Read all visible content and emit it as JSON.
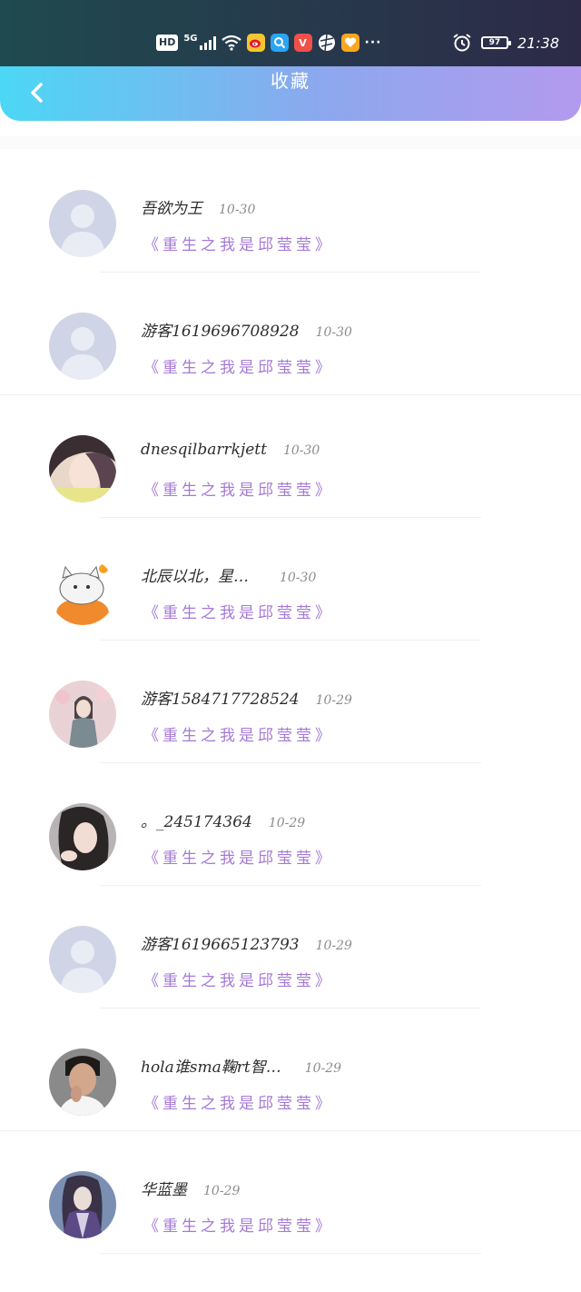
{
  "status_bar": {
    "hd": "HD",
    "network": "5G",
    "battery": "97",
    "time": "21:38",
    "more": "···",
    "app_icons": [
      "weibo-icon",
      "search-app-icon",
      "vip-app-icon",
      "browser-icon",
      "heart-app-icon"
    ]
  },
  "header": {
    "title": "收藏",
    "back_icon": "chevron-left-icon",
    "gradient": [
      "#4cd7f5",
      "#b39aee"
    ]
  },
  "accent_color": "#a57ad6",
  "items": [
    {
      "name": "吾欲为王",
      "date": "10-30",
      "book": "《重生之我是邱莹莹》",
      "avatar": "default"
    },
    {
      "name": "游客1619696708928",
      "date": "10-30",
      "book": "《重生之我是邱莹莹》",
      "avatar": "default"
    },
    {
      "name": "dnesqilbarrkjett",
      "date": "10-30",
      "book": "《重生之我是邱莹莹》",
      "avatar": "photo-girl"
    },
    {
      "name": "北辰以北，星…",
      "date": "10-30",
      "book": "《重生之我是邱莹莹》",
      "avatar": "cat"
    },
    {
      "name": "游客1584717728524",
      "date": "10-29",
      "book": "《重生之我是邱莹莹》",
      "avatar": "photo-child"
    },
    {
      "name": "。_245174364",
      "date": "10-29",
      "book": "《重生之我是邱莹莹》",
      "avatar": "photo-woman"
    },
    {
      "name": "游客1619665123793",
      "date": "10-29",
      "book": "《重生之我是邱莹莹》",
      "avatar": "default"
    },
    {
      "name": "hola谁sma鞠rt智…",
      "date": "10-29",
      "book": "《重生之我是邱莹莹》",
      "avatar": "photo-man"
    },
    {
      "name": "华蓝墨",
      "date": "10-29",
      "book": "《重生之我是邱莹莹》",
      "avatar": "anime"
    }
  ]
}
